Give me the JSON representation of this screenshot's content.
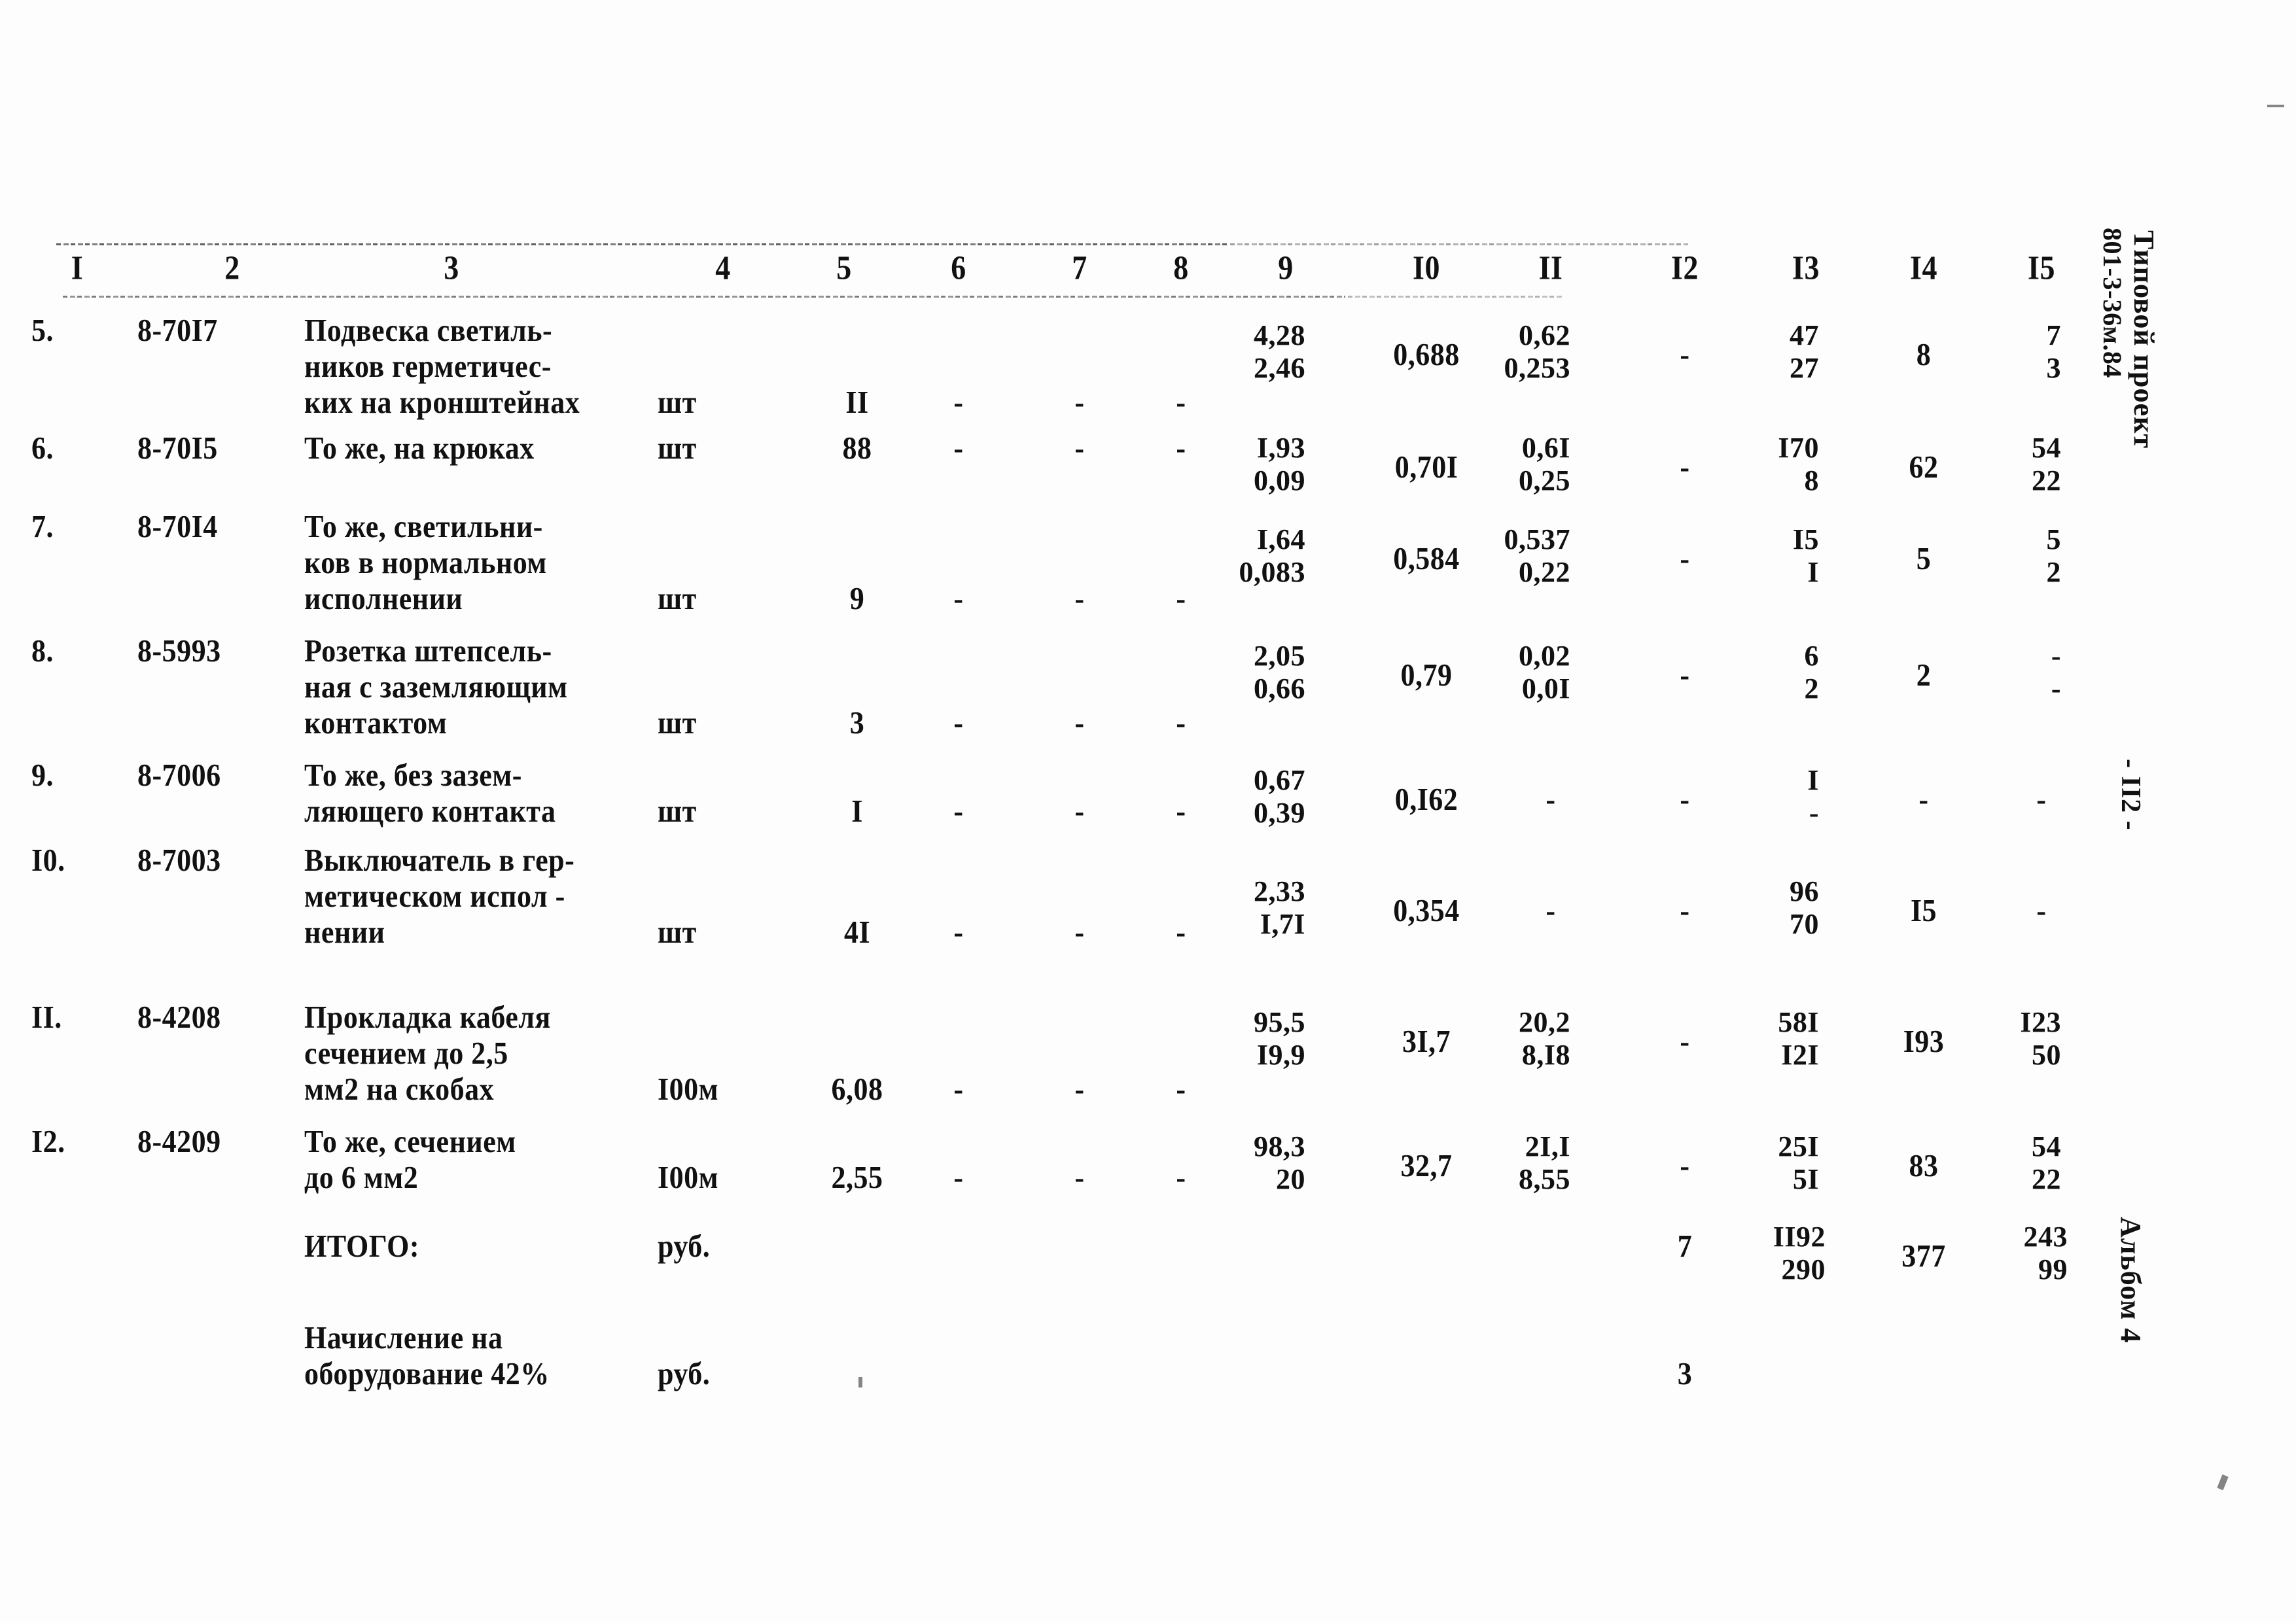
{
  "document": {
    "project_label": "Типовой проект",
    "project_code": "801-3-36м.84",
    "page_marker": "- II2 -",
    "album": "Альбом 4"
  },
  "table": {
    "column_numbers": [
      "I",
      "2",
      "3",
      "4",
      "5",
      "6",
      "7",
      "8",
      "9",
      "I0",
      "II",
      "I2",
      "I3",
      "I4",
      "I5"
    ],
    "rows": [
      {
        "no": "5.",
        "code": "8-70I7",
        "desc": [
          "Подвеска светиль-",
          "ников герметичес-",
          "ких на кронштейнах"
        ],
        "unit": "шт",
        "qty": "II",
        "c6": "-",
        "c7": "-",
        "c8": "-",
        "c9_top": "4,28",
        "c9_bot": "2,46",
        "c10": "0,688",
        "c11_top": "0,62",
        "c11_bot": "0,253",
        "c12": "-",
        "c13_top": "47",
        "c13_bot": "27",
        "c14": "8",
        "c15_top": "7",
        "c15_bot": "3"
      },
      {
        "no": "6.",
        "code": "8-70I5",
        "desc": [
          "То же, на крюках"
        ],
        "unit": "шт",
        "qty": "88",
        "c6": "-",
        "c7": "-",
        "c8": "-",
        "c9_top": "I,93",
        "c9_bot": "0,09",
        "c10": "0,70I",
        "c11_top": "0,6I",
        "c11_bot": "0,25",
        "c12": "-",
        "c13_top": "I70",
        "c13_bot": "8",
        "c14": "62",
        "c15_top": "54",
        "c15_bot": "22"
      },
      {
        "no": "7.",
        "code": "8-70I4",
        "desc": [
          "То же, светильни-",
          "ков в нормальном",
          "исполнении"
        ],
        "unit": "шт",
        "qty": "9",
        "c6": "-",
        "c7": "-",
        "c8": "-",
        "c9_top": "I,64",
        "c9_bot": "0,083",
        "c10": "0,584",
        "c11_top": "0,537",
        "c11_bot": "0,22",
        "c12": "-",
        "c13_top": "I5",
        "c13_bot": "I",
        "c14": "5",
        "c15_top": "5",
        "c15_bot": "2"
      },
      {
        "no": "8.",
        "code": "8-5993",
        "desc": [
          "Розетка штепсель-",
          "ная с заземляющим",
          "контактом"
        ],
        "unit": "шт",
        "qty": "3",
        "c6": "-",
        "c7": "-",
        "c8": "-",
        "c9_top": "2,05",
        "c9_bot": "0,66",
        "c10": "0,79",
        "c11_top": "0,02",
        "c11_bot": "0,0I",
        "c12": "-",
        "c13_top": "6",
        "c13_bot": "2",
        "c14": "2",
        "c15_top": "-",
        "c15_bot": "-"
      },
      {
        "no": "9.",
        "code": "8-7006",
        "desc": [
          "То же, без зазем-",
          "ляющего контакта"
        ],
        "unit": "шт",
        "qty": "I",
        "c6": "-",
        "c7": "-",
        "c8": "-",
        "c9_top": "0,67",
        "c9_bot": "0,39",
        "c10": "0,I62",
        "c11_top": "-",
        "c11_bot": "",
        "c12": "-",
        "c13_top": "I",
        "c13_bot": "-",
        "c14": "-",
        "c15_top": "-",
        "c15_bot": ""
      },
      {
        "no": "I0.",
        "code": "8-7003",
        "desc": [
          "Выключатель в гер-",
          "метическом испол -",
          "нении"
        ],
        "unit": "шт",
        "qty": "4I",
        "c6": "-",
        "c7": "-",
        "c8": "-",
        "c9_top": "2,33",
        "c9_bot": "I,7I",
        "c10": "0,354",
        "c11_top": "-",
        "c11_bot": "",
        "c12": "-",
        "c13_top": "96",
        "c13_bot": "70",
        "c14": "I5",
        "c15_top": "-",
        "c15_bot": ""
      },
      {
        "no": "II.",
        "code": "8-4208",
        "desc": [
          "Прокладка кабеля",
          "сечением до 2,5",
          "мм2 на скобах"
        ],
        "unit": "I00м",
        "qty": "6,08",
        "c6": "-",
        "c7": "-",
        "c8": "-",
        "c9_top": "95,5",
        "c9_bot": "I9,9",
        "c10": "3I,7",
        "c11_top": "20,2",
        "c11_bot": "8,I8",
        "c12": "-",
        "c13_top": "58I",
        "c13_bot": "I2I",
        "c14": "I93",
        "c15_top": "I23",
        "c15_bot": "50"
      },
      {
        "no": "I2.",
        "code": "8-4209",
        "desc": [
          "То же, сечением",
          "до 6 мм2"
        ],
        "unit": "I00м",
        "qty": "2,55",
        "c6": "-",
        "c7": "-",
        "c8": "-",
        "c9_top": "98,3",
        "c9_bot": "20",
        "c10": "32,7",
        "c11_top": "2I,I",
        "c11_bot": "8,55",
        "c12": "-",
        "c13_top": "25I",
        "c13_bot": "5I",
        "c14": "83",
        "c15_top": "54",
        "c15_bot": "22"
      }
    ],
    "summary_rows": [
      {
        "label": [
          "ИТОГО:"
        ],
        "unit": "руб.",
        "c12": "7",
        "c13_top": "II92",
        "c13_bot": "290",
        "c14": "377",
        "c15_top": "243",
        "c15_bot": "99"
      },
      {
        "label": [
          "Начисление на",
          "оборудование 42%"
        ],
        "unit": "руб.",
        "c12": "3",
        "c13_top": "",
        "c13_bot": "",
        "c14": "",
        "c15_top": "",
        "c15_bot": ""
      }
    ]
  }
}
